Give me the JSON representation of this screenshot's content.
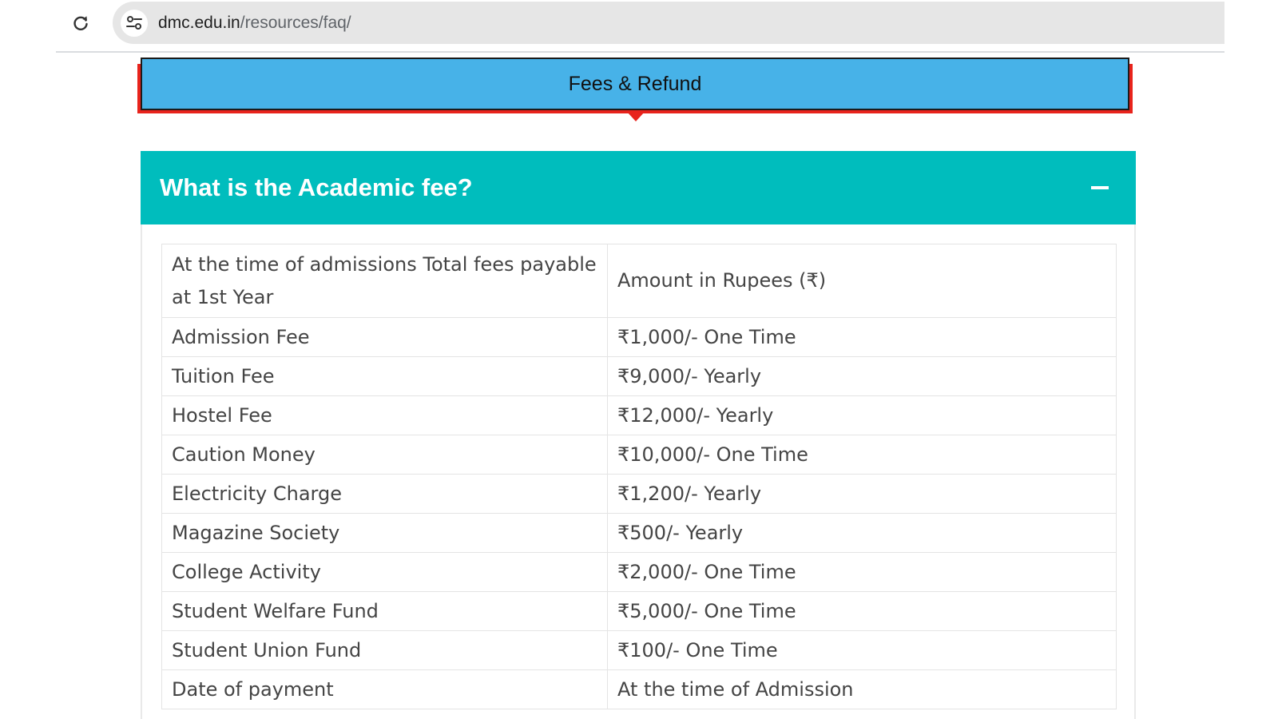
{
  "browser": {
    "url_domain": "dmc.edu.in",
    "url_path": "/resources/faq/",
    "reload_icon": "reload-icon",
    "site_info_icon": "tune-icon"
  },
  "tab": {
    "label": "Fees & Refund"
  },
  "accordion": {
    "title": "What is the Academic fee?",
    "toggle_icon": "minus-icon"
  },
  "fee_table": {
    "header": {
      "col1": "At the time of admissions Total fees payable at 1st Year",
      "col2": "Amount in Rupees (₹)"
    },
    "rows": [
      {
        "item": "Admission Fee",
        "amount": "₹1,000/- One Time"
      },
      {
        "item": "Tuition Fee",
        "amount": "₹9,000/- Yearly"
      },
      {
        "item": "Hostel Fee",
        "amount": "₹12,000/- Yearly"
      },
      {
        "item": "Caution Money",
        "amount": "₹10,000/- One Time"
      },
      {
        "item": "Electricity Charge",
        "amount": "₹1,200/- Yearly"
      },
      {
        "item": "Magazine Society",
        "amount": "₹500/- Yearly"
      },
      {
        "item": "College Activity",
        "amount": "₹2,000/- One Time"
      },
      {
        "item": "Student Welfare Fund",
        "amount": "₹5,000/- One Time"
      },
      {
        "item": "Student Union Fund",
        "amount": "₹100/- One Time"
      },
      {
        "item": "Date of payment",
        "amount": "At the time of Admission"
      }
    ]
  },
  "colors": {
    "tab_bg": "#47b2e8",
    "tab_accent": "#e8231c",
    "accordion_header": "#00bdbd"
  }
}
